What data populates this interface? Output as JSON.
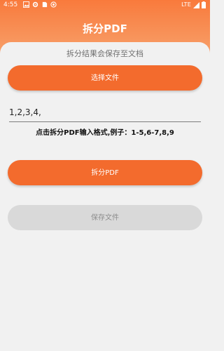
{
  "status_bar": {
    "time": "4:55",
    "network": "LTE",
    "icons": [
      "image-icon",
      "gear-icon",
      "sd-card-icon",
      "app-icon",
      "signal-icon",
      "battery-icon"
    ]
  },
  "header": {
    "title": "拆分PDF"
  },
  "main": {
    "hint_top": "拆分结果会保存至文档",
    "select_file_label": "选择文件",
    "input_value": "1,2,3,4,",
    "format_hint": "点击拆分PDF输入格式,例子：1-5,6-7,8,9",
    "split_label": "拆分PDF",
    "save_label": "保存文件"
  },
  "colors": {
    "accent": "#f36b2d",
    "header_top": "#f97a3c",
    "disabled": "#d9d9d9"
  }
}
